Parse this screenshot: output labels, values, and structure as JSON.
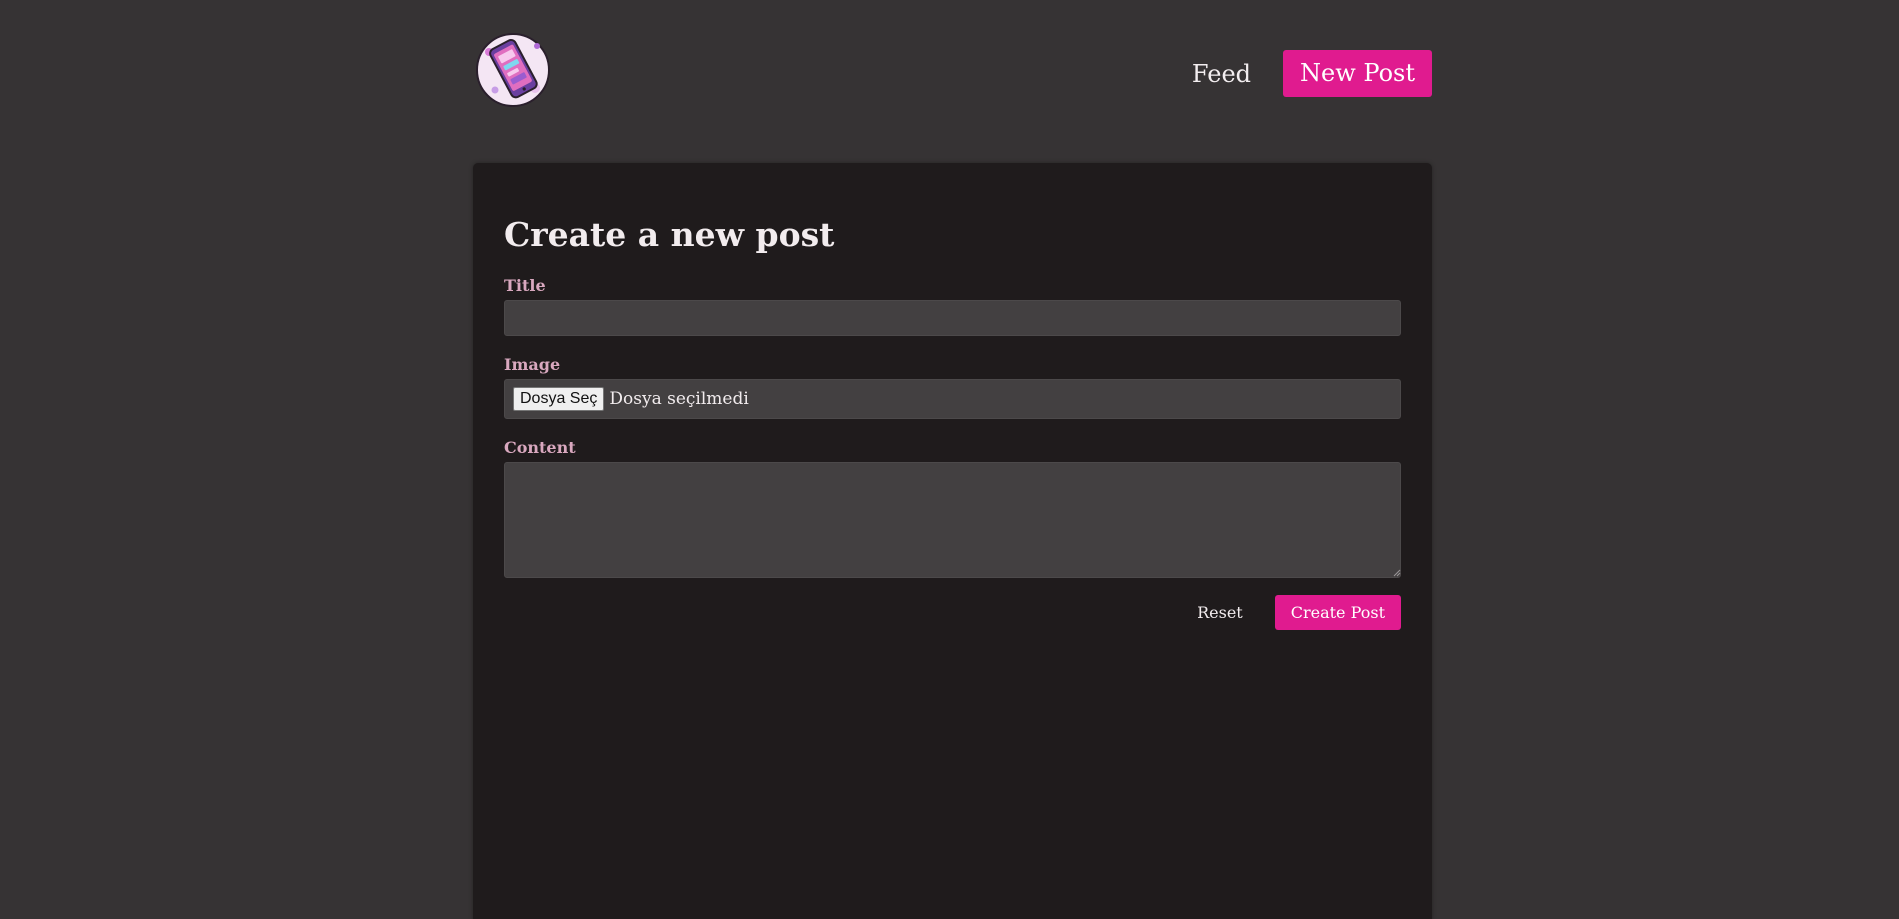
{
  "nav": {
    "feed_label": "Feed",
    "new_post_label": "New Post"
  },
  "form": {
    "heading": "Create a new post",
    "title_label": "Title",
    "title_value": "",
    "image_label": "Image",
    "file_button_label": "Dosya Seç",
    "file_status": "Dosya seçilmedi",
    "content_label": "Content",
    "content_value": "",
    "reset_label": "Reset",
    "submit_label": "Create Post"
  },
  "colors": {
    "background": "#363334",
    "card": "#1f1b1c",
    "accent": "#e01b8f",
    "label": "#d9a8bf",
    "input": "#434041"
  },
  "icons": {
    "logo": "smartphone-illustration-logo"
  }
}
